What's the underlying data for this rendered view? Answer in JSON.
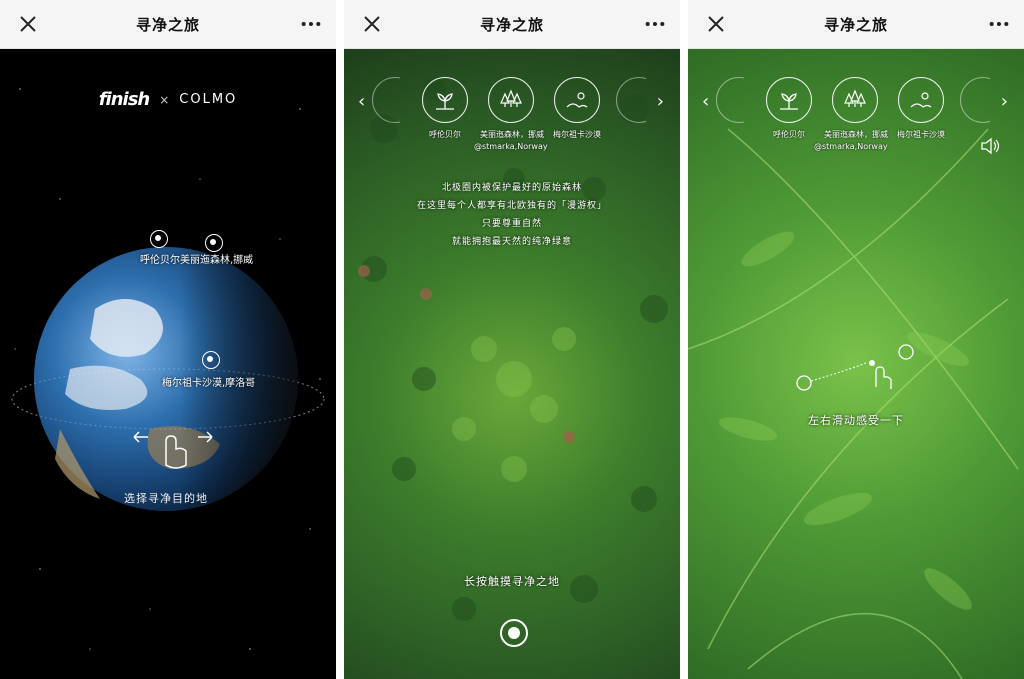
{
  "window": {
    "title": "寻净之旅",
    "close_icon": "close-icon",
    "more_icon": "more-icon"
  },
  "panel1": {
    "brand_left": "finish",
    "brand_sep": "×",
    "brand_right": "COLMO",
    "label_top_left": "呼伦贝尔",
    "label_top_right": "美丽迤森林,挪威",
    "label_mid": "梅尔祖卡沙漠,摩洛哥",
    "hint": "选择寻净目的地"
  },
  "panel2": {
    "categories": [
      {
        "name": "呼伦贝尔",
        "icon": "plant-icon"
      },
      {
        "name": "美丽迤森林，挪威",
        "icon": "forest-icon"
      },
      {
        "name": "梅尔祖卡沙漠",
        "icon": "desert-icon"
      }
    ],
    "credit": "@stmarka,Norway",
    "poem": [
      "北极圈内被保护最好的原始森林",
      "在这里每个人都享有北欧独有的「漫游权」",
      "只要尊重自然",
      "就能拥抱最天然的纯净绿意"
    ],
    "hint": "长按触摸寻净之地"
  },
  "panel3": {
    "categories": [
      {
        "name": "呼伦贝尔",
        "icon": "plant-icon"
      },
      {
        "name": "美丽迤森林，挪威",
        "icon": "forest-icon"
      },
      {
        "name": "梅尔祖卡沙漠",
        "icon": "desert-icon"
      }
    ],
    "credit": "@stmarka,Norway",
    "hint": "左右滑动感受一下"
  }
}
